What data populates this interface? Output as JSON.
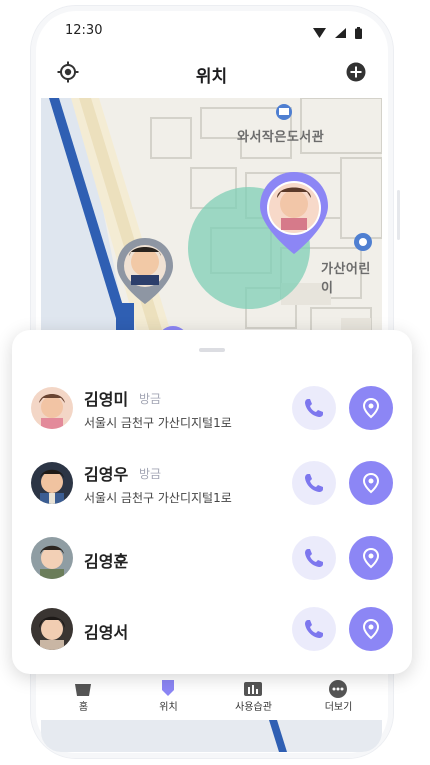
{
  "status_bar": {
    "time": "12:30"
  },
  "header": {
    "title": "위치",
    "left_icon": "locate-icon",
    "right_icon": "add-circle-icon"
  },
  "map": {
    "labels": {
      "library": "와서작은도서관",
      "kindergarten": "가산어린이"
    },
    "colors": {
      "geofence": "#7fcfb6",
      "pin_active": "#8c86f5",
      "pin_inactive": "#8e96a3",
      "rail": "#2f5fb3"
    }
  },
  "members": [
    {
      "name": "김영미",
      "time": "방금",
      "address": "서울시 금천구 가산디지털1로"
    },
    {
      "name": "김영우",
      "time": "방금",
      "address": "서울시 금천구 가산디지털1로"
    },
    {
      "name": "김영훈"
    },
    {
      "name": "김영서"
    }
  ],
  "actions": {
    "call_icon": "phone-icon",
    "locate_icon": "map-pin-icon"
  },
  "nav": {
    "items": [
      {
        "label": "홈",
        "icon": "home-icon"
      },
      {
        "label": "위치",
        "icon": "location-icon"
      },
      {
        "label": "사용습관",
        "icon": "chart-icon"
      },
      {
        "label": "더보기",
        "icon": "more-icon"
      }
    ]
  },
  "accent": "#8c86f5"
}
